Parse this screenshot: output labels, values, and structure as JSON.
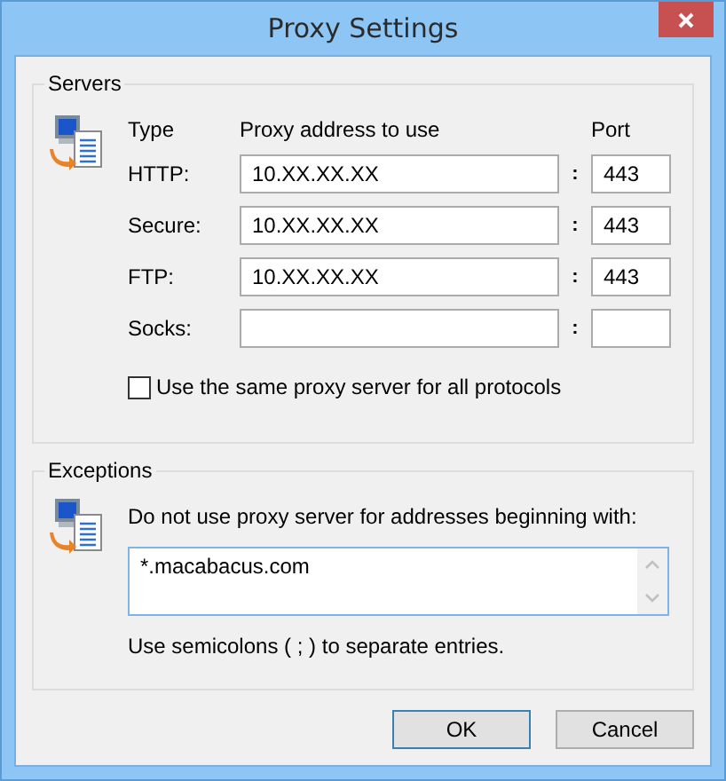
{
  "window": {
    "title": "Proxy Settings"
  },
  "servers": {
    "legend": "Servers",
    "columns": [
      "Type",
      "Proxy address to use",
      "Port"
    ],
    "rows": [
      {
        "label": "HTTP:",
        "address": "10.XX.XX.XX",
        "separator": ":",
        "port": "443"
      },
      {
        "label": "Secure:",
        "address": "10.XX.XX.XX",
        "separator": ":",
        "port": "443"
      },
      {
        "label": "FTP:",
        "address": "10.XX.XX.XX",
        "separator": ":",
        "port": "443"
      },
      {
        "label": "Socks:",
        "separator": ":"
      }
    ],
    "same_proxy": {
      "label": "Use the same proxy server for all protocols",
      "checked": false
    }
  },
  "exceptions": {
    "legend": "Exceptions",
    "instruction": "Do not use proxy server for addresses beginning with:",
    "value": "*.macabacus.com",
    "note": "Use semicolons ( ; ) to separate entries."
  },
  "buttons": [
    {
      "label": "OK",
      "default": true
    },
    {
      "label": "Cancel",
      "default": false
    }
  ]
}
